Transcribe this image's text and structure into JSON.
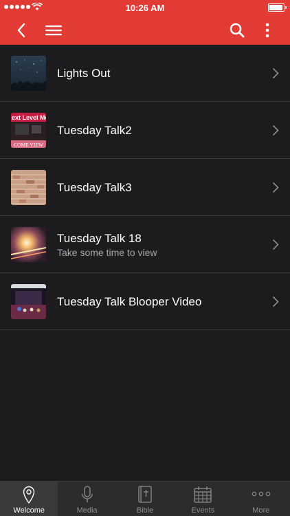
{
  "status_bar": {
    "time": "10:26 AM"
  },
  "colors": {
    "accent": "#e23b35",
    "background": "#1c1c1e",
    "tab_bar": "#2c2c2e"
  },
  "nav": {
    "back_icon": "chevron-left-icon",
    "menu_icon": "hamburger-menu-icon",
    "search_icon": "search-icon",
    "more_icon": "vertical-dots-icon"
  },
  "items": [
    {
      "title": "Lights Out",
      "subtitle": "",
      "thumbnail": "night-sky-thumbnail"
    },
    {
      "title": "Tuesday Talk2",
      "subtitle": "",
      "thumbnail": "next-level-thumbnail",
      "thumb_text_top": "ext Level Mo",
      "thumb_text_bottom": "COME VIEW"
    },
    {
      "title": "Tuesday Talk3",
      "subtitle": "",
      "thumbnail": "brick-wall-thumbnail"
    },
    {
      "title": "Tuesday Talk 18",
      "subtitle": "Take some time to view",
      "thumbnail": "road-lights-thumbnail"
    },
    {
      "title": "Tuesday Talk Blooper Video",
      "subtitle": "",
      "thumbnail": "stage-thumbnail"
    }
  ],
  "tabs": [
    {
      "label": "Welcome",
      "icon": "map-pin-icon",
      "active": true
    },
    {
      "label": "Media",
      "icon": "microphone-icon",
      "active": false
    },
    {
      "label": "Bible",
      "icon": "bible-icon",
      "active": false
    },
    {
      "label": "Events",
      "icon": "calendar-icon",
      "active": false
    },
    {
      "label": "More",
      "icon": "ellipsis-icon",
      "active": false
    }
  ]
}
